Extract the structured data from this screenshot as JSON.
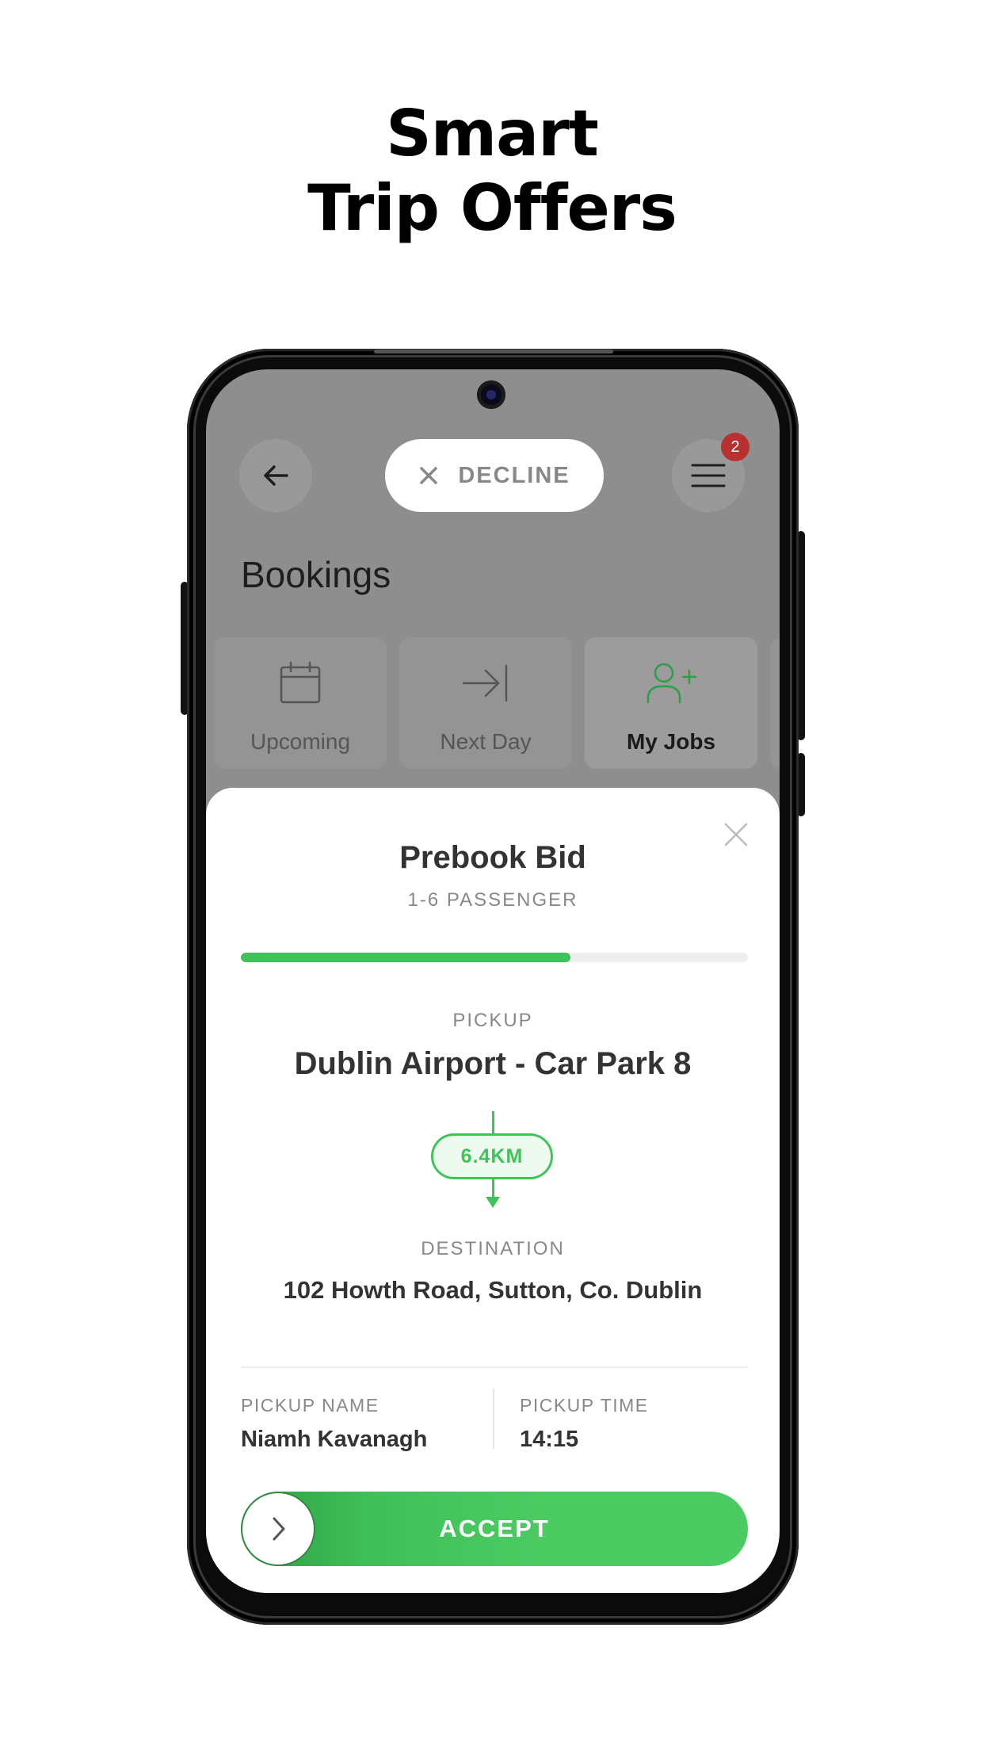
{
  "headline": {
    "line1": "Smart",
    "line2": "Trip Offers"
  },
  "header": {
    "decline_label": "DECLINE",
    "menu_badge": "2",
    "title": "Bookings"
  },
  "tabs": [
    {
      "label": "Upcoming",
      "icon": "calendar-icon"
    },
    {
      "label": "Next Day",
      "icon": "arrow-to-end-icon"
    },
    {
      "label": "My Jobs",
      "icon": "add-user-icon",
      "active": true
    }
  ],
  "offer": {
    "title": "Prebook Bid",
    "subtitle": "1-6 PASSENGER",
    "progress": 0.65,
    "pickup_caption": "PICKUP",
    "pickup": "Dublin Airport - Car Park 8",
    "distance": "6.4KM",
    "destination_caption": "DESTINATION",
    "destination": "102 Howth Road, Sutton, Co. Dublin",
    "pickup_name_caption": "PICKUP NAME",
    "pickup_name": "Niamh Kavanagh",
    "pickup_time_caption": "PICKUP TIME",
    "pickup_time": "14:15",
    "accept_label": "ACCEPT"
  },
  "colors": {
    "accent": "#3fc45a",
    "badge": "#b83030",
    "overlay": "#8e8e8e"
  }
}
